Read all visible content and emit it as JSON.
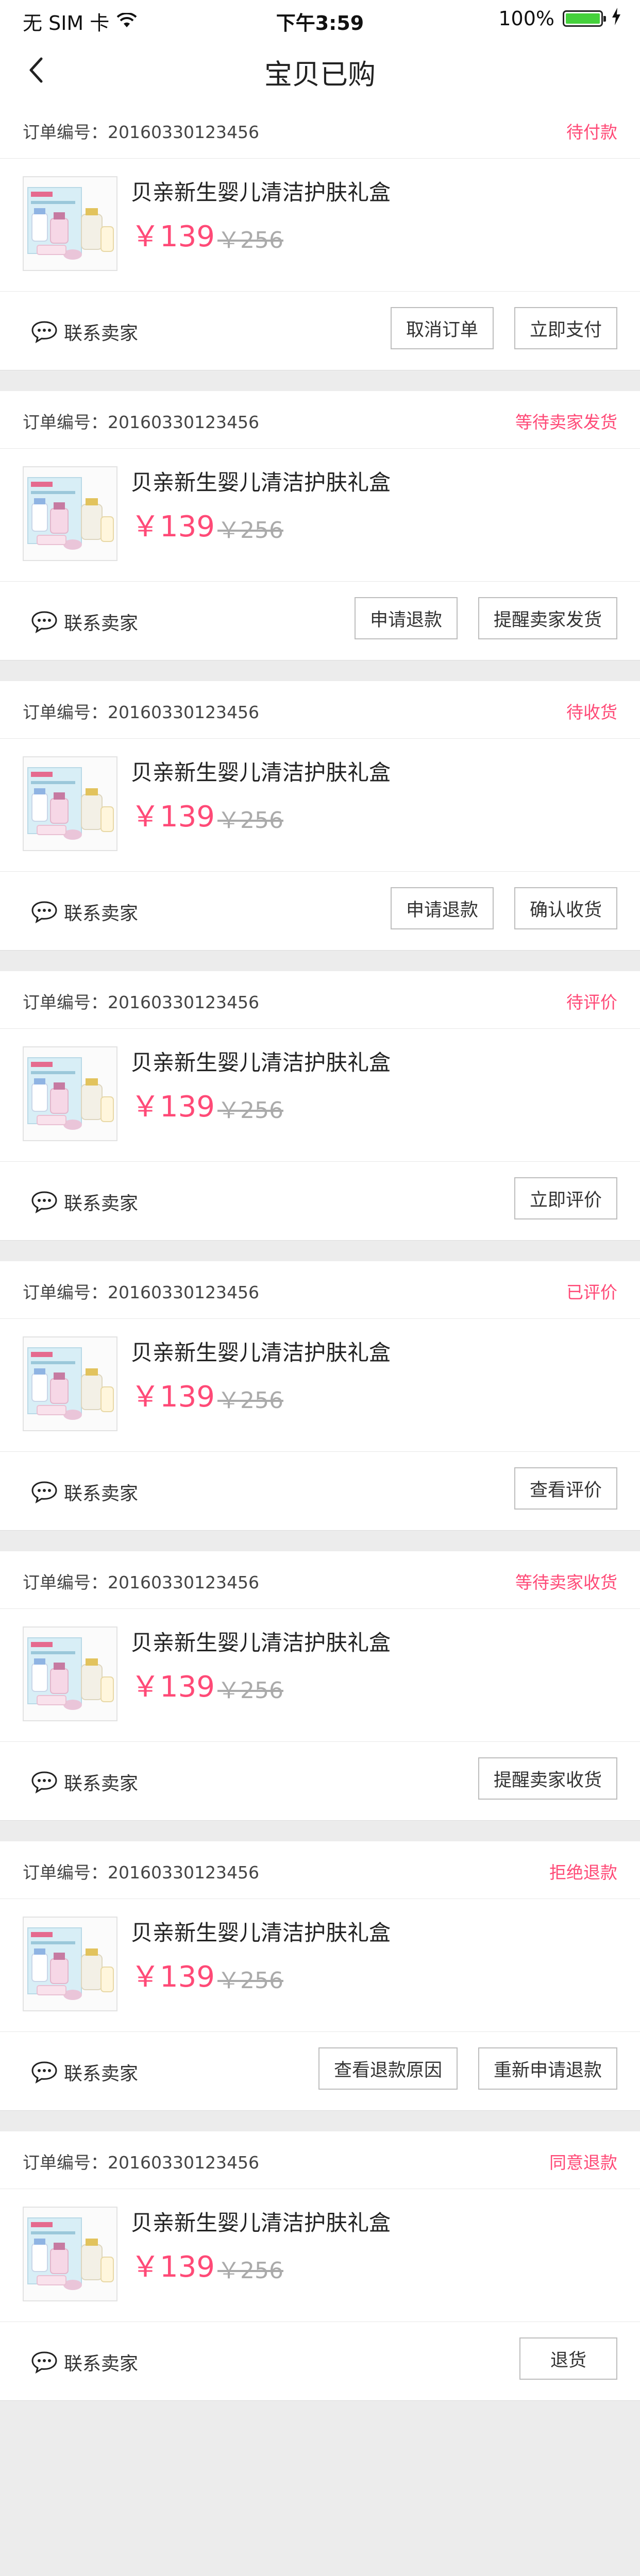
{
  "status_bar": {
    "carrier": "无 SIM 卡",
    "time": "下午3:59",
    "battery": "100%",
    "battery_level": 1.0,
    "battery_color": "#45d13c"
  },
  "nav": {
    "title": "宝贝已购"
  },
  "colors": {
    "status_accent": "#ff4a77",
    "price_accent": "#ff4a77",
    "background": "#ececec"
  },
  "contact_label": "联系卖家",
  "orders": [
    {
      "order_number": "订单编号：20160330123456",
      "status": "待付款",
      "product_name": "贝亲新生婴儿清洁护肤礼盒",
      "price": "￥139",
      "original_price": "￥256",
      "buttons": [
        "取消订单",
        "立即支付"
      ]
    },
    {
      "order_number": "订单编号：20160330123456",
      "status": "等待卖家发货",
      "product_name": "贝亲新生婴儿清洁护肤礼盒",
      "price": "￥139",
      "original_price": "￥256",
      "buttons": [
        "申请退款",
        "提醒卖家发货"
      ]
    },
    {
      "order_number": "订单编号：20160330123456",
      "status": "待收货",
      "product_name": "贝亲新生婴儿清洁护肤礼盒",
      "price": "￥139",
      "original_price": "￥256",
      "buttons": [
        "申请退款",
        "确认收货"
      ]
    },
    {
      "order_number": "订单编号：20160330123456",
      "status": "待评价",
      "product_name": "贝亲新生婴儿清洁护肤礼盒",
      "price": "￥139",
      "original_price": "￥256",
      "buttons": [
        "立即评价"
      ]
    },
    {
      "order_number": "订单编号：20160330123456",
      "status": "已评价",
      "product_name": "贝亲新生婴儿清洁护肤礼盒",
      "price": "￥139",
      "original_price": "￥256",
      "buttons": [
        "查看评价"
      ]
    },
    {
      "order_number": "订单编号：20160330123456",
      "status": "等待卖家收货",
      "product_name": "贝亲新生婴儿清洁护肤礼盒",
      "price": "￥139",
      "original_price": "￥256",
      "buttons": [
        "提醒卖家收货"
      ]
    },
    {
      "order_number": "订单编号：20160330123456",
      "status": "拒绝退款",
      "product_name": "贝亲新生婴儿清洁护肤礼盒",
      "price": "￥139",
      "original_price": "￥256",
      "buttons": [
        "查看退款原因",
        "重新申请退款"
      ]
    },
    {
      "order_number": "订单编号：20160330123456",
      "status": "同意退款",
      "product_name": "贝亲新生婴儿清洁护肤礼盒",
      "price": "￥139",
      "original_price": "￥256",
      "buttons": [
        "退货"
      ]
    }
  ]
}
